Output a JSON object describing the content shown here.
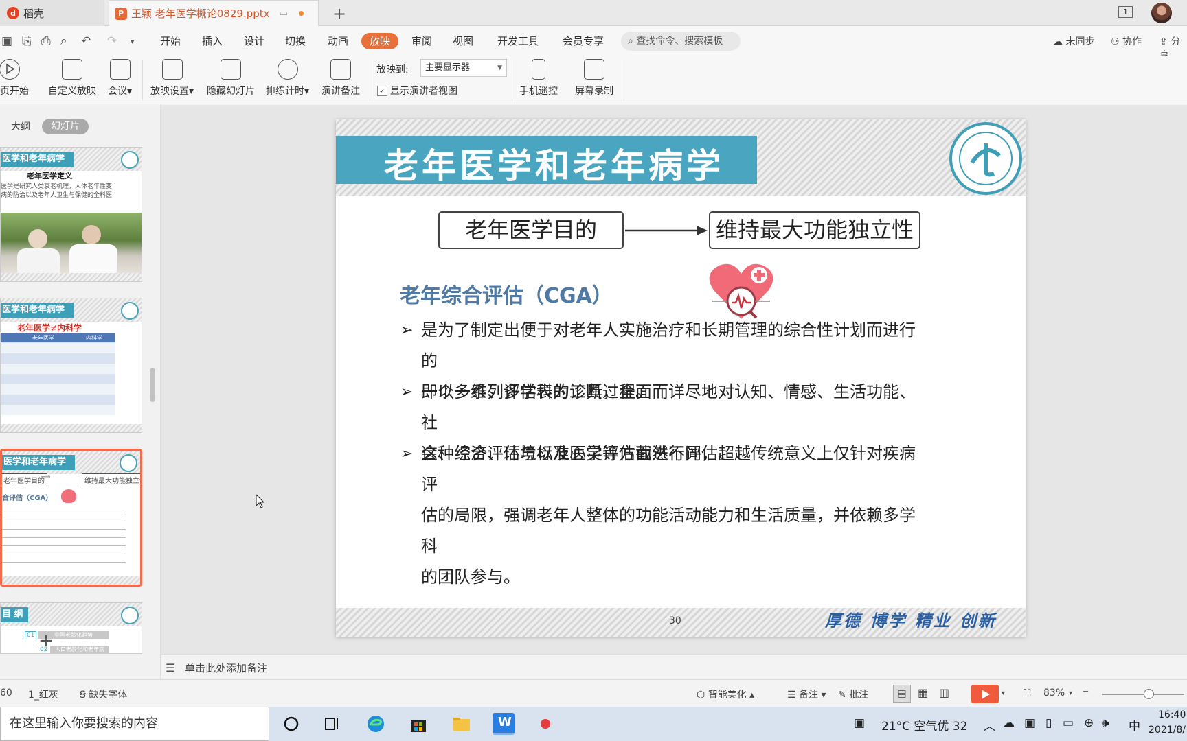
{
  "tabs": {
    "home_label": "稻壳",
    "doc_label": "王颖 老年医学概论0829.pptx",
    "window_count": "1"
  },
  "menu": {
    "items": [
      "开始",
      "插入",
      "设计",
      "切换",
      "动画",
      "放映",
      "审阅",
      "视图",
      "开发工具",
      "会员专享"
    ],
    "active": "放映",
    "search_placeholder": "查找命令、搜索模板",
    "sync_label": "未同步",
    "collab_label": "协作",
    "share_label": "分享"
  },
  "ribbon": {
    "from_current": "当页开始",
    "custom_show": "自定义放映",
    "meeting": "会议",
    "show_settings": "放映设置",
    "hide_slide": "隐藏幻灯片",
    "rehearse": "排练计时",
    "speaker_notes": "演讲备注",
    "play_to_label": "放映到:",
    "play_to_value": "主要显示器",
    "presenter_view": "显示演讲者视图",
    "presenter_checked": true,
    "phone_remote": "手机遥控",
    "screen_record": "屏幕录制"
  },
  "leftpane": {
    "outline_tab": "大纲",
    "slides_tab": "幻灯片",
    "thumb1": {
      "header": "医学和老年病学",
      "title": "老年医学定义",
      "line1": "医学是研究人类衰老机理，人体老年性变",
      "line2": "病的防治以及老年人卫生与保健的全科医"
    },
    "thumb2": {
      "header": "医学和老年病学",
      "title": "老年医学≠内科学",
      "col1": "老年医学",
      "col2": "内科学"
    },
    "thumb3": {
      "header": "医学和老年病学",
      "flow_left": "老年医学目的",
      "flow_right": "维持最大功能独立性",
      "cga": "合评估（CGA）"
    },
    "thumb4": {
      "header": "目 纲",
      "num1": "01",
      "item1": "中国老龄化趋势",
      "num2": "02",
      "item2": "人口老龄化和老年病"
    }
  },
  "slide": {
    "title": "老年医学和老年病学",
    "flow_left": "老年医学目的",
    "flow_right": "维持最大功能独立性",
    "heading": "老年综合评估（CGA）",
    "bullets": [
      {
        "line1": "是为了制定出便于对老年人实施治疗和长期管理的综合性计划而进行的",
        "line2": "一个多维、多学科的诊断过程。"
      },
      {
        "line1": "即以一系列评估表为工具，全面而详尽地对认知、情感、生活功能、社",
        "line2": "会、经济、环境以及心灵等方面进行评估。"
      },
      {
        "line1": "这种综合评估与标准医学评估截然不同，超越传统意义上仅针对疾病评",
        "line2": "估的局限，强调老年人整体的功能活动能力和生活质量，并依赖多学科",
        "line3": "的团队参与。"
      }
    ],
    "page_number": "30",
    "motto": "厚德  博学  精业  创新"
  },
  "notes": {
    "placeholder": "单击此处添加备注"
  },
  "statusbar": {
    "slide_count": "60",
    "theme": "1_红灰",
    "missing_font": "缺失字体",
    "smart_beautify": "智能美化",
    "notes": "备注",
    "comments": "批注",
    "zoom": "83%",
    "zoom_fraction": 0.83
  },
  "taskbar": {
    "search_placeholder": "在这里输入你要搜索的内容",
    "weather": "21°C 空气优 32",
    "ime": "中",
    "time": "16:40",
    "date": "2021/8/"
  },
  "colors": {
    "accent": "#e8703a",
    "slide_title_bar": "#4aa6c0",
    "heading_blue": "#4f7aa5",
    "play_red": "#f05a3d"
  }
}
